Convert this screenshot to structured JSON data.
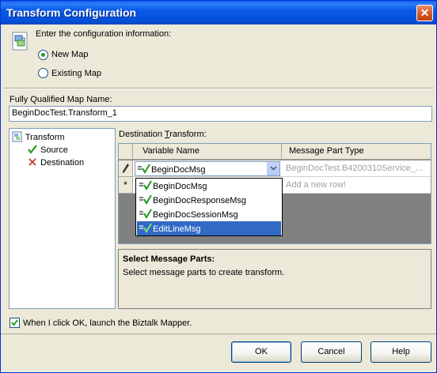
{
  "window": {
    "title": "Transform Configuration"
  },
  "header": {
    "instruction": "Enter the configuration information:"
  },
  "map_options": {
    "new_map": {
      "label": "New Map",
      "selected": true
    },
    "existing_map": {
      "label": "Existing Map",
      "selected": false
    }
  },
  "map_name": {
    "label": "Fully Qualified Map Name:",
    "value": "BeginDocTest.Transform_1"
  },
  "tree": {
    "root": "Transform",
    "children": [
      {
        "label": "Source",
        "icon": "checkmark-icon"
      },
      {
        "label": "Destination",
        "icon": "x-icon"
      }
    ]
  },
  "destination": {
    "label": "Destination Transform:",
    "columns": [
      "Variable Name",
      "Message Part Type"
    ],
    "rows": [
      {
        "indicator": "✎",
        "variable": "BeginDocMsg",
        "type": "BeginDocTest.B4200310Service_..."
      },
      {
        "indicator": "*",
        "variable": "",
        "type": "Add a new row!"
      }
    ],
    "dropdown_options": [
      "BeginDocMsg",
      "BeginDocResponseMsg",
      "BeginDocSessionMsg",
      "EditLineMsg"
    ],
    "dropdown_selected_index": 3
  },
  "description": {
    "title": "Select Message Parts:",
    "text": "Select message parts to create transform."
  },
  "launch_option": {
    "label": "When I click OK, launch the Biztalk Mapper.",
    "checked": true
  },
  "buttons": {
    "ok": "OK",
    "cancel": "Cancel",
    "help": "Help"
  },
  "colors": {
    "title_bar": "#0a5ae8",
    "selection": "#316ac5",
    "dialog_bg": "#ece9d8"
  }
}
